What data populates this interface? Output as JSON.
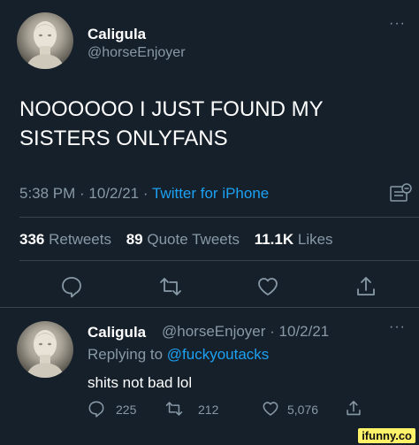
{
  "tweet": {
    "display_name": "Caligula",
    "handle": "@horseEnjoyer",
    "more_icon": "ellipsis-icon",
    "text": "NOOOOOO I JUST FOUND MY SISTERS ONLYFANS",
    "time": "5:38 PM",
    "date": "10/2/21",
    "separator": " · ",
    "source": "Twitter for iPhone",
    "retweets_count": "336",
    "retweets_label": "Retweets",
    "quotes_count": "89",
    "quotes_label": "Quote Tweets",
    "likes_count": "11.1K",
    "likes_label": "Likes"
  },
  "reply": {
    "display_name": "Caligula",
    "handle_and_date": "@horseEnjoyer · 10/2/21",
    "replying_prefix": "Replying to ",
    "replying_to": "@fuckyoutacks",
    "text": "shits not bad lol",
    "replies": "225",
    "retweets": "212",
    "likes": "5,076"
  },
  "watermark": "ifunny.co",
  "colors": {
    "background": "#15202b",
    "secondary_text": "#8899a6",
    "accent": "#1da1f2",
    "divider": "#38444d"
  }
}
